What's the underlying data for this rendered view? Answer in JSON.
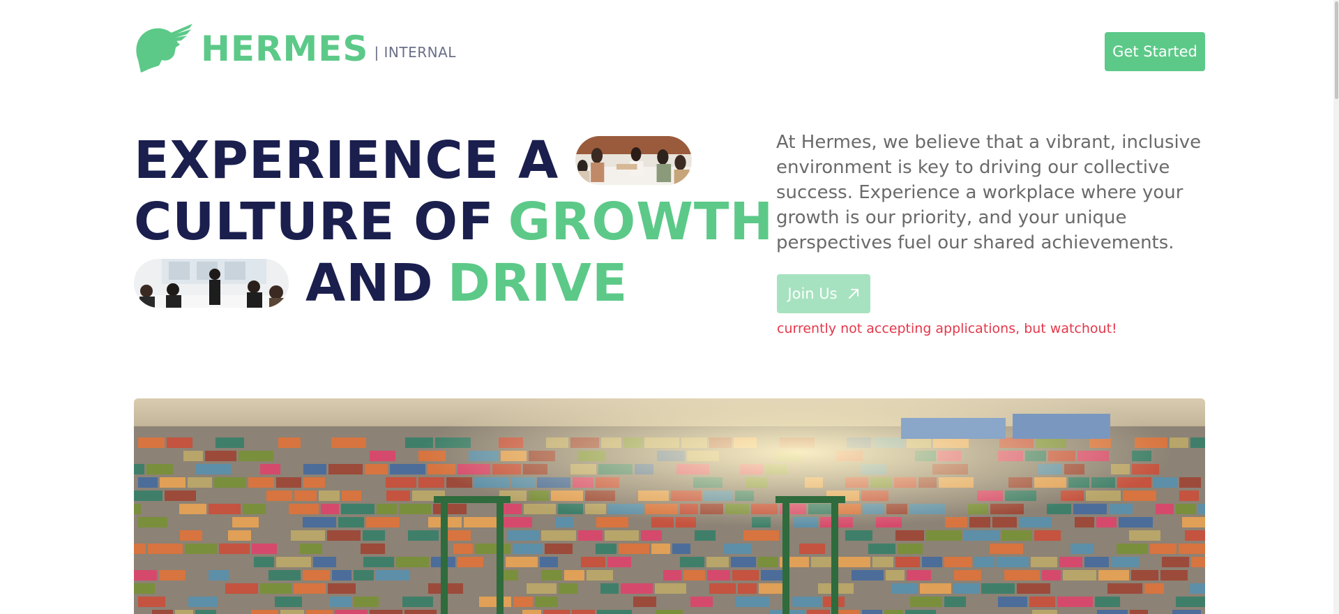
{
  "header": {
    "logo_icon": "winged-helmet-icon",
    "logo_text": "HERMES",
    "logo_sub": "| INTERNAL",
    "cta_label": "Get Started"
  },
  "hero": {
    "line1_text": "EXPERIENCE A",
    "line2_text": "CULTURE OF",
    "line2_accent": "GROWTH",
    "line3_text": "AND",
    "line3_accent": "DRIVE",
    "intro": "At Hermes, we believe that a vibrant, inclusive environment is key to driving our collective success. Experience a workplace where your growth is our priority, and your unique perspectives fuel our shared achievements.",
    "join_label": "Join Us",
    "join_icon": "arrow-up-right-icon",
    "join_disabled": true,
    "notice": "currently not accepting applications, but watchout!"
  },
  "images": {
    "pill_1": "team-meeting-photo",
    "pill_2": "office-discussion-photo",
    "banner": "shipping-container-port-photo"
  },
  "colors": {
    "brand_green": "#5cc988",
    "navy": "#1a1f4e",
    "muted_text": "#6a6a6a",
    "disabled_green": "#a6e2bf",
    "notice_red": "#e5374a"
  }
}
